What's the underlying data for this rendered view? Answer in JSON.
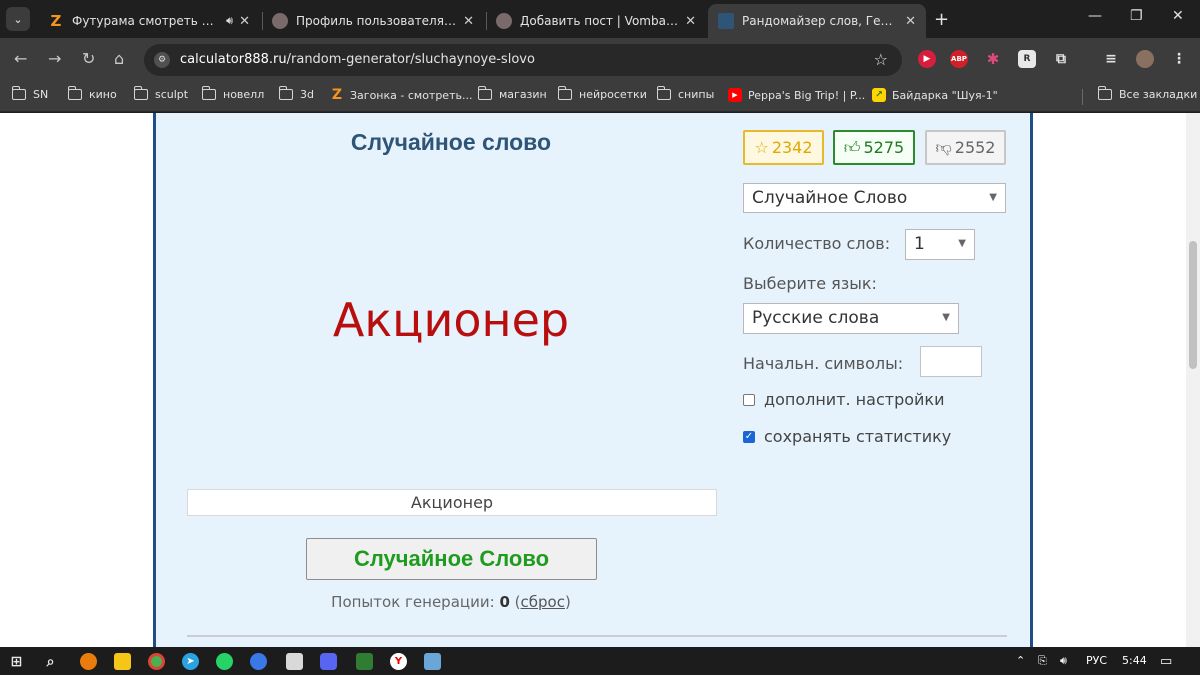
{
  "browser": {
    "tabs": [
      {
        "title": "Футурама смотреть онлай",
        "favicon_text": "Z",
        "favicon_color": "#f7931e",
        "audio": true
      },
      {
        "title": "Профиль пользователя PyKAM",
        "favicon_text": "",
        "favicon_color": "#8a8a8a",
        "audio": false
      },
      {
        "title": "Добавить пост | Vombat.su",
        "favicon_text": "",
        "favicon_color": "#8a8a8a",
        "audio": false
      },
      {
        "title": "Рандомайзер слов, Генератор",
        "favicon_text": "",
        "favicon_color": "#2e5578",
        "audio": false
      }
    ],
    "url_host": "calculator888.ru",
    "url_path": "/random-generator/sluchaynoye-slovo",
    "bookmarks": [
      {
        "label": "SN",
        "type": "folder"
      },
      {
        "label": "кино",
        "type": "folder"
      },
      {
        "label": "sculpt",
        "type": "folder"
      },
      {
        "label": "новелл",
        "type": "folder"
      },
      {
        "label": "3d",
        "type": "folder"
      },
      {
        "label": "Загонка - смотреть...",
        "type": "site"
      },
      {
        "label": "магазин",
        "type": "folder"
      },
      {
        "label": "нейросетки",
        "type": "folder"
      },
      {
        "label": "снипы",
        "type": "folder"
      },
      {
        "label": "Peppa's Big Trip! | P...",
        "type": "site"
      },
      {
        "label": "Байдарка \"Шуя-1\"",
        "type": "site"
      }
    ],
    "all_bookmarks": "Все закладки",
    "extensions": {
      "abp": "ABP",
      "r": "R"
    }
  },
  "page": {
    "title": "Случайное слово",
    "big_word": "Акционер",
    "word_box": "Акционер",
    "generate_button": "Случайное Слово",
    "attempts_label": "Попыток генерации:",
    "attempts_count": "0",
    "reset_label": "сброс",
    "ratings": {
      "favorites": "2342",
      "likes": "5275",
      "dislikes": "2552"
    },
    "mode_select": "Случайное Слово",
    "count_label": "Количество слов:",
    "count_value": "1",
    "language_label": "Выберите язык:",
    "language_value": "Русские слова",
    "start_chars_label": "Начальн. символы:",
    "extra_settings_label": "дополнит. настройки",
    "save_stats_label": "сохранять статистику",
    "extra_settings_checked": false,
    "save_stats_checked": true
  },
  "taskbar": {
    "language": "РУС",
    "time": "5:44"
  },
  "colors": {
    "panel_bg": "#e6f3fc",
    "panel_border": "#1d4f86",
    "word_red": "#b80e0e",
    "button_green": "#1f9c1f"
  }
}
